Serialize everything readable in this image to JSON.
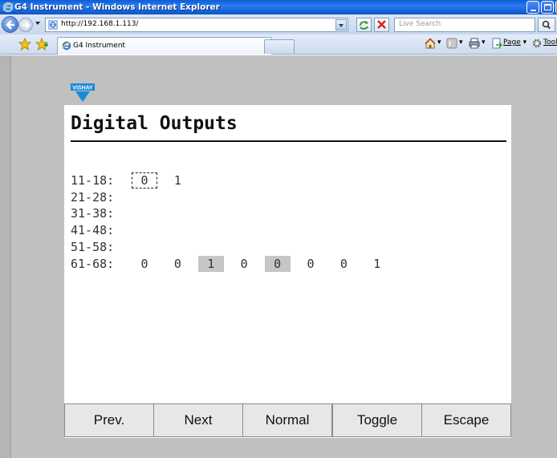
{
  "window": {
    "title": "G4 Instrument - Windows Internet Explorer"
  },
  "browser": {
    "url": "http://192.168.1.113/",
    "search_placeholder": "Live Search",
    "tab_title": "G4 Instrument",
    "page_menu_label": "Page",
    "tools_menu_label": "Tools"
  },
  "logo": {
    "text": "VISHAY"
  },
  "page": {
    "title": "Digital Outputs",
    "rows": [
      {
        "label": "11-18:",
        "values": [
          "0",
          "1"
        ],
        "focused_index": 0,
        "shaded_indices": []
      },
      {
        "label": "21-28:",
        "values": [],
        "focused_index": null,
        "shaded_indices": []
      },
      {
        "label": "31-38:",
        "values": [],
        "focused_index": null,
        "shaded_indices": []
      },
      {
        "label": "41-48:",
        "values": [],
        "focused_index": null,
        "shaded_indices": []
      },
      {
        "label": "51-58:",
        "values": [],
        "focused_index": null,
        "shaded_indices": []
      },
      {
        "label": "61-68:",
        "values": [
          "0",
          "0",
          "1",
          "0",
          "0",
          "0",
          "0",
          "1"
        ],
        "focused_index": null,
        "shaded_indices": [
          2,
          4
        ]
      }
    ]
  },
  "softkeys": [
    "Prev.",
    "Next",
    "Normal",
    "Toggle",
    "Escape"
  ],
  "colors": {
    "titlebar": "#0a5fd8",
    "viewport_bg": "#c0c0c0",
    "panel_bg": "#ffffff",
    "shaded_cell": "#c6c6c6",
    "button_bg": "#e7e7e7",
    "logo_blue": "#1a8ad8"
  }
}
